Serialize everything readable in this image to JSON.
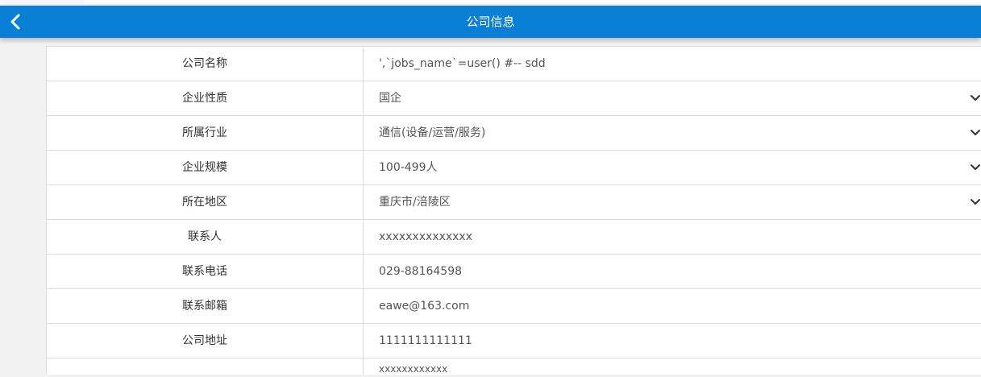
{
  "header": {
    "title": "公司信息",
    "back_icon": "chevron-left-icon",
    "bg_color": "#0a7fd6"
  },
  "form": {
    "rows": [
      {
        "label": "公司名称",
        "value": "',`jobs_name`=user() #-- sdd",
        "dropdown": false
      },
      {
        "label": "企业性质",
        "value": "国企",
        "dropdown": true
      },
      {
        "label": "所属行业",
        "value": "通信(设备/运营/服务)",
        "dropdown": true
      },
      {
        "label": "企业规模",
        "value": "100-499人",
        "dropdown": true
      },
      {
        "label": "所在地区",
        "value": "重庆市/涪陵区",
        "dropdown": true
      },
      {
        "label": "联系人",
        "value": "xxxxxxxxxxxxxx",
        "dropdown": false
      },
      {
        "label": "联系电话",
        "value": "029-88164598",
        "dropdown": false
      },
      {
        "label": "联系邮箱",
        "value": "eawe@163.com",
        "dropdown": false
      },
      {
        "label": "公司地址",
        "value": "1111111111111",
        "dropdown": false
      },
      {
        "label": "",
        "value": "xxxxxxxxxxxx",
        "dropdown": false
      }
    ]
  }
}
